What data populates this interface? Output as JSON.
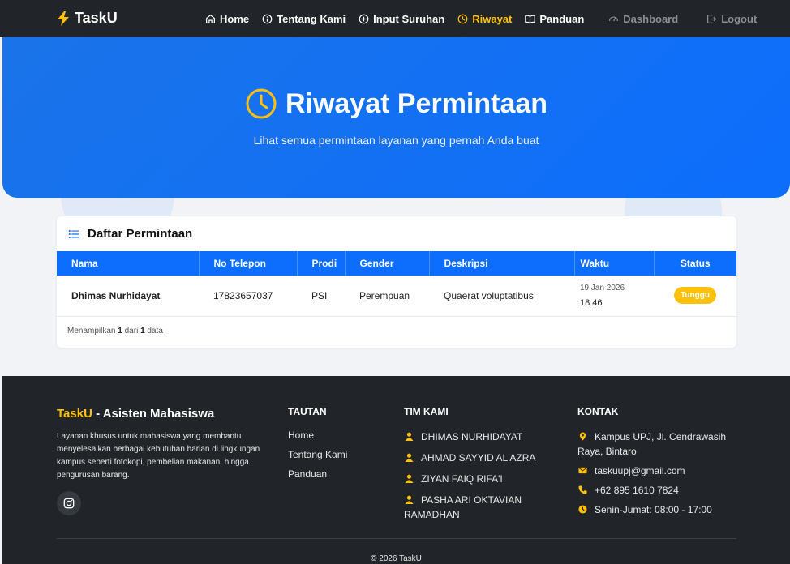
{
  "navbar": {
    "brand": "TaskU",
    "items": [
      {
        "label": "Home",
        "icon": "home-icon"
      },
      {
        "label": "Tentang Kami",
        "icon": "info-icon"
      },
      {
        "label": "Input Suruhan",
        "icon": "plus-circle-icon"
      },
      {
        "label": "Riwayat",
        "icon": "clock-icon"
      },
      {
        "label": "Panduan",
        "icon": "book-icon"
      },
      {
        "label": "Dashboard",
        "icon": "speedometer-icon"
      },
      {
        "label": "Logout",
        "icon": "logout-icon"
      }
    ],
    "active": "Riwayat"
  },
  "hero": {
    "title": "Riwayat Permintaan",
    "subtitle": "Lihat semua permintaan layanan yang pernah Anda buat"
  },
  "card": {
    "title": "Daftar Permintaan",
    "columns": [
      "Nama",
      "No Telepon",
      "Prodi",
      "Gender",
      "Deskripsi",
      "Waktu",
      "Status"
    ],
    "rows": [
      {
        "nama": "Dhimas Nurhidayat",
        "telepon": "17823657037",
        "prodi": "PSI",
        "gender": "Perempuan",
        "deskripsi": "Quaerat voluptatibus",
        "tanggal": "19 Jan 2026",
        "jam": "18:46",
        "status": "Tunggu"
      }
    ],
    "footer_prefix": "Menampilkan",
    "shown": "1",
    "footer_mid": "dari",
    "total": "1",
    "footer_suffix": "data"
  },
  "footer": {
    "brand_main": "TaskU",
    "brand_rest": " - Asisten Mahasiswa",
    "description": "Layanan khusus untuk mahasiswa yang membantu menyelesaikan berbagai kebutuhan harian di lingkungan kampus seperti fotokopi, pembelian makanan, hingga pengurusan barang.",
    "links_title": "TAUTAN",
    "links": [
      "Home",
      "Tentang Kami",
      "Panduan"
    ],
    "team_title": "TIM KAMI",
    "team": [
      "DHIMAS NURHIDAYAT",
      "AHMAD SAYYID AL AZRA",
      "ZIYAN FAIQ RIFA'I",
      "PASHA ARI OKTAVIAN RAMADHAN"
    ],
    "contact_title": "KONTAK",
    "contact": {
      "address": "Kampus UPJ, Jl. Cendrawasih Raya, Bintaro",
      "email": "taskuupj@gmail.com",
      "phone": "+62 895 1610 7824",
      "hours": "Senin-Jumat: 08:00 - 17:00"
    },
    "copyright": "© 2026 TaskU"
  },
  "colors": {
    "accent": "#ffc107",
    "primary": "#0d6efd",
    "dark": "#212529"
  }
}
